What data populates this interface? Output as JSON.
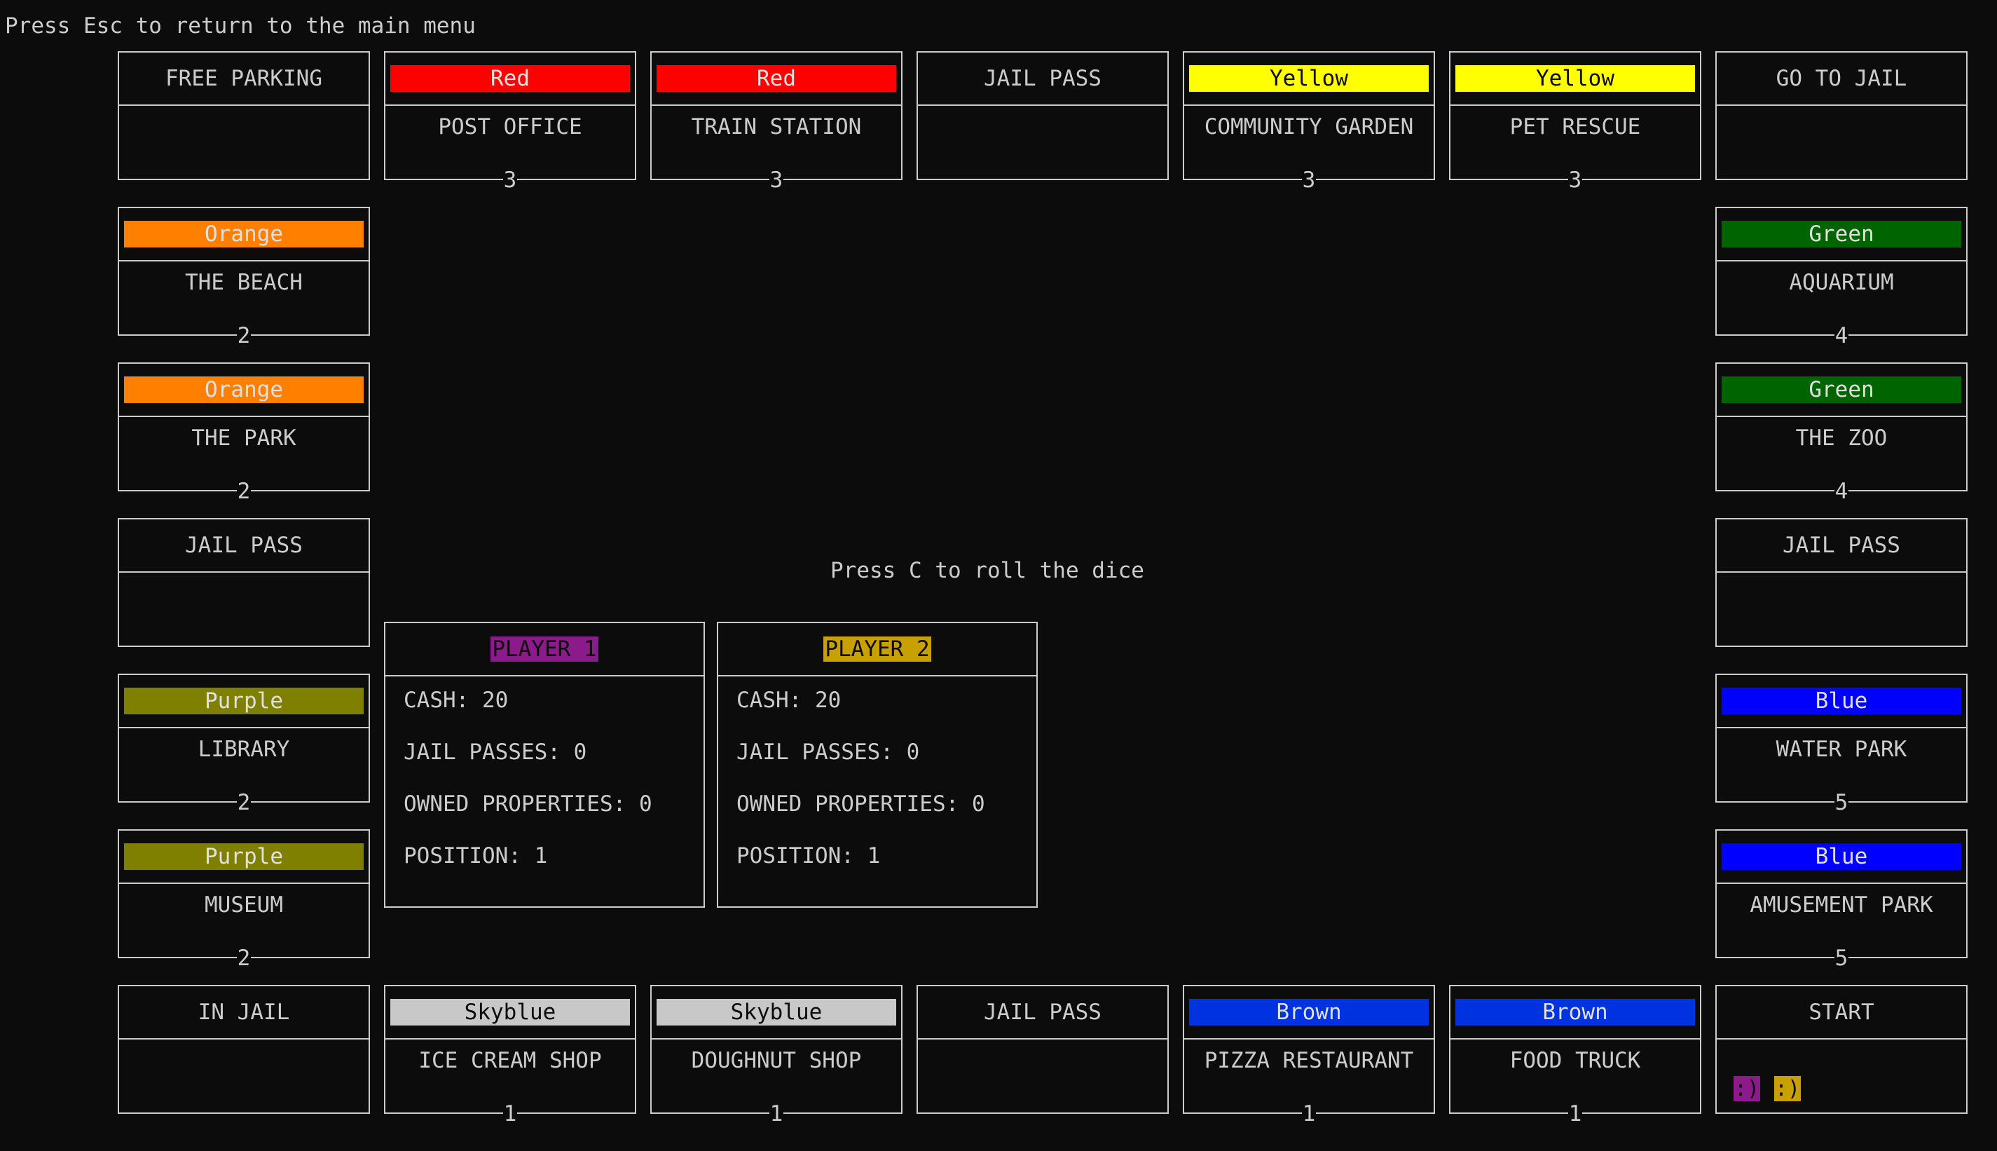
{
  "hint_top": "Press Esc to return to the main menu",
  "hint_center": "Press C to roll the dice",
  "colors": {
    "background": "#0c0c0c",
    "foreground": "#cccccc",
    "Red": "#ff0000",
    "Yellow": "#ffff00",
    "Orange": "#ff8000",
    "Green": "#006400",
    "Purple": "#808000",
    "Blue": "#0000ff",
    "Skyblue": "#c8c8c8",
    "Brown": "#0033e0",
    "player1": "#8b1a8b",
    "player2": "#c8a000"
  },
  "top_row": [
    {
      "header": "FREE PARKING",
      "name": "",
      "price": ""
    },
    {
      "color": "Red",
      "name": "POST OFFICE",
      "price": "3"
    },
    {
      "color": "Red",
      "name": "TRAIN STATION",
      "price": "3"
    },
    {
      "header": "JAIL PASS",
      "name": "",
      "price": ""
    },
    {
      "color": "Yellow",
      "name": "COMMUNITY GARDEN",
      "price": "3"
    },
    {
      "color": "Yellow",
      "name": "PET RESCUE",
      "price": "3"
    },
    {
      "header": "GO TO JAIL",
      "name": "",
      "price": ""
    }
  ],
  "left_col": [
    {
      "color": "Orange",
      "name": "THE BEACH",
      "price": "2"
    },
    {
      "color": "Orange",
      "name": "THE PARK",
      "price": "2"
    },
    {
      "header": "JAIL PASS",
      "name": "",
      "price": ""
    },
    {
      "color": "Purple",
      "name": "LIBRARY",
      "price": "2"
    },
    {
      "color": "Purple",
      "name": "MUSEUM",
      "price": "2"
    }
  ],
  "right_col": [
    {
      "color": "Green",
      "name": "AQUARIUM",
      "price": "4"
    },
    {
      "color": "Green",
      "name": "THE ZOO",
      "price": "4"
    },
    {
      "header": "JAIL PASS",
      "name": "",
      "price": ""
    },
    {
      "color": "Blue",
      "name": "WATER PARK",
      "price": "5"
    },
    {
      "color": "Blue",
      "name": "AMUSEMENT PARK",
      "price": "5"
    }
  ],
  "bottom_row": [
    {
      "header": "IN JAIL",
      "name": "",
      "price": ""
    },
    {
      "color": "Skyblue",
      "name": "ICE CREAM SHOP",
      "price": "1"
    },
    {
      "color": "Skyblue",
      "name": "DOUGHNUT SHOP",
      "price": "1"
    },
    {
      "header": "JAIL PASS",
      "name": "",
      "price": ""
    },
    {
      "color": "Brown",
      "name": "PIZZA RESTAURANT",
      "price": "1"
    },
    {
      "color": "Brown",
      "name": "FOOD TRUCK",
      "price": "1"
    },
    {
      "header": "START",
      "name": "",
      "price": ""
    }
  ],
  "tokens": [
    ":)",
    ":)"
  ],
  "players": [
    {
      "title": "PLAYER 1",
      "cash_label": "CASH:",
      "cash": "20",
      "jail_label": "JAIL PASSES:",
      "jail_passes": "0",
      "owned_label": "OWNED PROPERTIES:",
      "owned": "0",
      "position_label": "POSITION:",
      "position": "1"
    },
    {
      "title": "PLAYER 2",
      "cash_label": "CASH:",
      "cash": "20",
      "jail_label": "JAIL PASSES:",
      "jail_passes": "0",
      "owned_label": "OWNED PROPERTIES:",
      "owned": "0",
      "position_label": "POSITION:",
      "position": "1"
    }
  ]
}
